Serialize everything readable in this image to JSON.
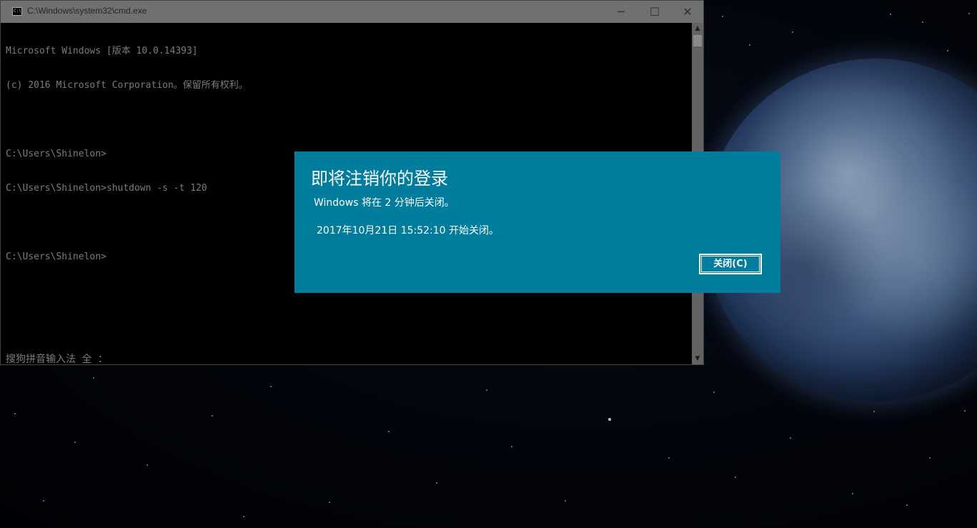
{
  "cmd_window": {
    "title": "C:\\Windows\\system32\\cmd.exe",
    "icon": "cmd-icon",
    "icon_text": "C:\\",
    "controls": {
      "minimize": "─",
      "maximize": "☐",
      "close": "✕"
    },
    "lines": [
      "Microsoft Windows [版本 10.0.14393]",
      "(c) 2016 Microsoft Corporation。保留所有权利。",
      "",
      "C:\\Users\\Shinelon>",
      "C:\\Users\\Shinelon>shutdown -s -t 120",
      "",
      "C:\\Users\\Shinelon>"
    ],
    "ime_status": "搜狗拼音输入法 全 ：",
    "scroll_up": "▲",
    "scroll_down": "▼"
  },
  "dialog": {
    "title": "即将注销你的登录",
    "message": "Windows 将在 2 分钟后关闭。",
    "time": "2017年10月21日 15:52:10 开始关闭。",
    "close_button": "关闭(C)",
    "accent_color": "#007c9c"
  }
}
